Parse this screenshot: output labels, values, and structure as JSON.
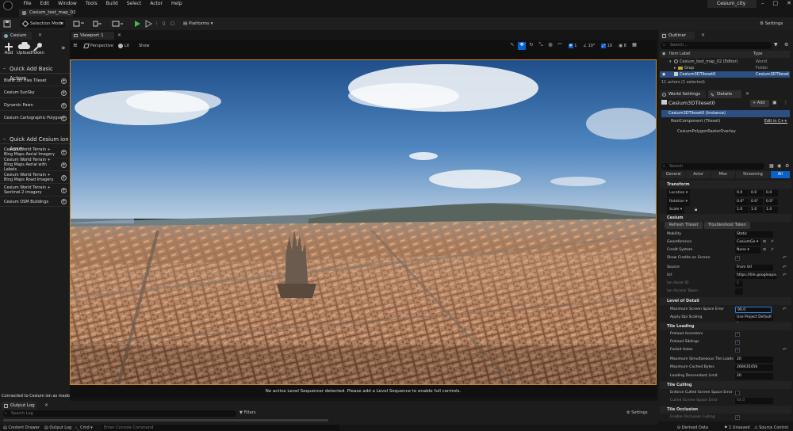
{
  "menu": [
    "File",
    "Edit",
    "Window",
    "Tools",
    "Build",
    "Select",
    "Actor",
    "Help"
  ],
  "project_name": "Cesium_city",
  "doc_tab": "Cesium_test_map_02",
  "toolbar": {
    "mode": "Selection Mode",
    "platforms": "Platforms",
    "settings": "Settings"
  },
  "left_panel": {
    "tab": "Cesium",
    "buttons": [
      {
        "label": "Add"
      },
      {
        "label": "Upload"
      },
      {
        "label": "Token"
      }
    ],
    "quick_add_title": "Quick Add Basic Actors",
    "basic_actors": [
      "Blank 3D Tiles Tileset",
      "Cesium SunSky",
      "Dynamic Pawn",
      "Cesium Cartographic Polygon"
    ],
    "ion_title": "Quick Add Cesium ion Asse",
    "ion_assets": [
      "Cesium World Terrain + Bing Maps Aerial Imagery",
      "Cesium World Terrain + Bing Maps Aerial with Labels",
      "Cesium World Terrain + Bing Maps Road Imagery",
      "Cesium World Terrain + Sentinel-2 imagery",
      "Cesium OSM Buildings"
    ],
    "status": "Connected to Cesium ion as madoolo"
  },
  "viewport": {
    "tab": "Viewport 1",
    "perspective": "Perspective",
    "lit": "Lit",
    "show": "Show",
    "grid_snap": "1",
    "rot_snap": "10°",
    "scale_snap": "10",
    "cam_speed": "8",
    "sequencer_msg": "No active Level Sequencer detected. Please add a Level Sequence to enable full controls."
  },
  "outliner": {
    "tab": "Outliner",
    "search_placeholder": "Search...",
    "col_label": "Item Label",
    "col_type": "Type",
    "rows": [
      {
        "label": "Cesium_test_map_02 (Editor)",
        "type": "World"
      },
      {
        "label": "Grap",
        "type": "Folder"
      },
      {
        "label": "Cesium3DTileset0",
        "type": "Cesium3DTileset"
      }
    ],
    "count": "11 actors (1 selected)"
  },
  "details": {
    "tab_world": "World Settings",
    "tab_details": "Details",
    "actor_name": "Cesium3DTileset0",
    "add_label": "Add",
    "instance": "Cesium3DTileset0 (Instance)",
    "root": "RootComponent (Tileset)",
    "edit_cpp": "Edit in C++",
    "raster": "CesiumPolygonRasterOverlay",
    "search_placeholder": "Search",
    "filter_tabs": [
      "General",
      "Actor",
      "Misc",
      "Streaming",
      "All"
    ],
    "transform_title": "Transform",
    "location_label": "Location",
    "rotation_label": "Rotation",
    "scale_label": "Scale",
    "location": [
      "0.0",
      "0.0",
      "0.0"
    ],
    "rotation": [
      "0.0°",
      "0.0°",
      "0.0°"
    ],
    "scale": [
      "1.0",
      "1.0",
      "1.0"
    ],
    "cesium_title": "Cesium",
    "refresh": "Refresh Tileset",
    "troubleshoot": "Troubleshoot Token",
    "mobility_label": "Mobility",
    "mobility": "Static",
    "georef_label": "Georeference",
    "georef": "CesiumGe",
    "credit_label": "Credit System",
    "credit": "None",
    "show_credits_label": "Show Credits on Screen",
    "source_label": "Source",
    "source": "From Url",
    "url_label": "Url",
    "url": "https://tile.googleapis.co",
    "ion_asset_id_label": "Ion Asset ID",
    "ion_asset_id": "0",
    "ion_token_label": "Ion Access Token",
    "lod_title": "Level of Detail",
    "msse_label": "Maximum Screen Space Error",
    "msse": "90.0",
    "dpi_label": "Apply Dpi Scaling",
    "dpi": "Use Project Default",
    "tile_loading_title": "Tile Loading",
    "preload_ancestors_label": "Preload Ancestors",
    "preload_siblings_label": "Preload Siblings",
    "forbid_holes_label": "Forbid Holes",
    "max_loads_label": "Maximum Simultaneous Tile Loads",
    "max_loads": "20",
    "max_bytes_label": "Maximum Cached Bytes",
    "max_bytes": "268435456",
    "desc_limit_label": "Loading Descendant Limit",
    "desc_limit": "20",
    "tile_culling_title": "Tile Culling",
    "culled_label": "Enforce Culled Screen Space Error",
    "culled_sse_label": "Culled Screen Space Error",
    "culled_sse": "64.0",
    "occlusion_title": "Tile Occlusion",
    "occlusion_label": "Enable Occlusion Culling"
  },
  "output_log": {
    "tab": "Output Log",
    "search_placeholder": "Search Log",
    "filters": "Filters",
    "settings": "Settings"
  },
  "statusbar": {
    "content_drawer": "Content Drawer",
    "output_log": "Output Log",
    "cmd": "Cmd",
    "cmd_placeholder": "Enter Console Command",
    "derived": "Derived Data",
    "unsaved": "1 Unsaved",
    "source_control": "Source Control"
  }
}
